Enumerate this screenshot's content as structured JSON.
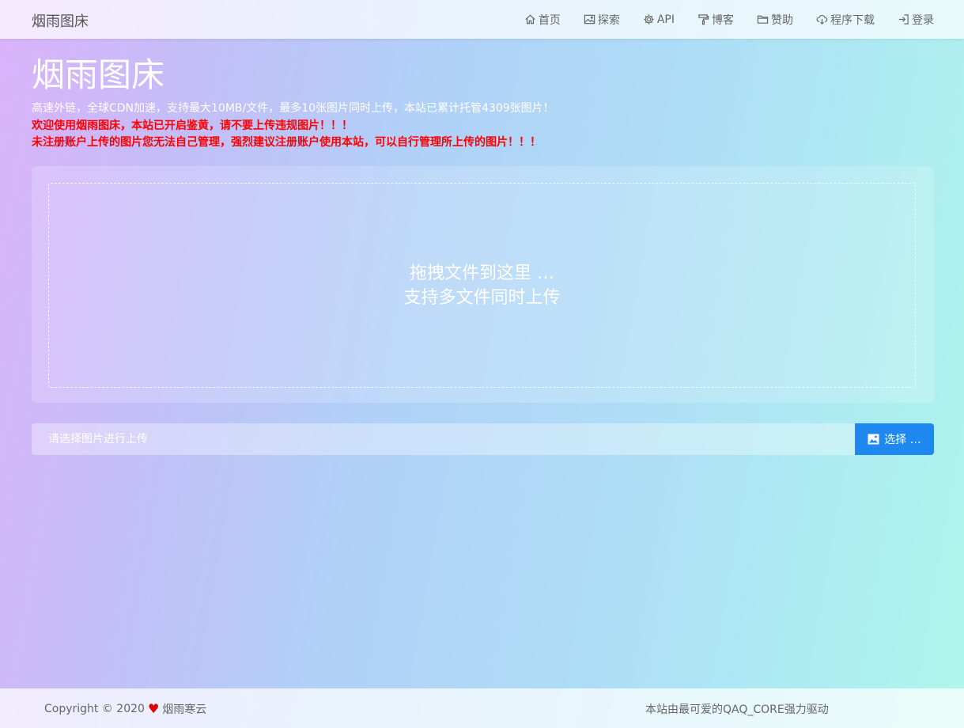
{
  "navbar": {
    "brand": "烟雨图床",
    "items": [
      {
        "icon": "home-icon",
        "label": "首页"
      },
      {
        "icon": "image-icon",
        "label": "探索"
      },
      {
        "icon": "gear-icon",
        "label": "API"
      },
      {
        "icon": "paint-roller-icon",
        "label": "博客"
      },
      {
        "icon": "folder-icon",
        "label": "赞助"
      },
      {
        "icon": "cloud-download-icon",
        "label": "程序下载"
      },
      {
        "icon": "sign-in-icon",
        "label": "登录"
      }
    ]
  },
  "hero": {
    "title": "烟雨图床",
    "description": "高速外链，全球CDN加速，支持最大10MB/文件，最多10张图片同时上传，本站已累计托管4309张图片！",
    "warning1": "欢迎使用烟雨图床，本站已开启鉴黄，请不要上传违规图片！！！",
    "warning2": "未注册账户上传的图片您无法自己管理，强烈建议注册账户使用本站，可以自行管理所上传的图片！！！"
  },
  "dropzone": {
    "line1": "拖拽文件到这里 …",
    "line2": "支持多文件同时上传"
  },
  "upload": {
    "placeholder": "请选择图片进行上传",
    "button_label": "选择 …",
    "button_color": "#1e87f0"
  },
  "footer": {
    "copyright": "Copyright © 2020",
    "author": "烟雨寒云",
    "powered_by": "本站由最可爱的QAQ_CORE强力驱动",
    "heart_color": "#e00000"
  }
}
